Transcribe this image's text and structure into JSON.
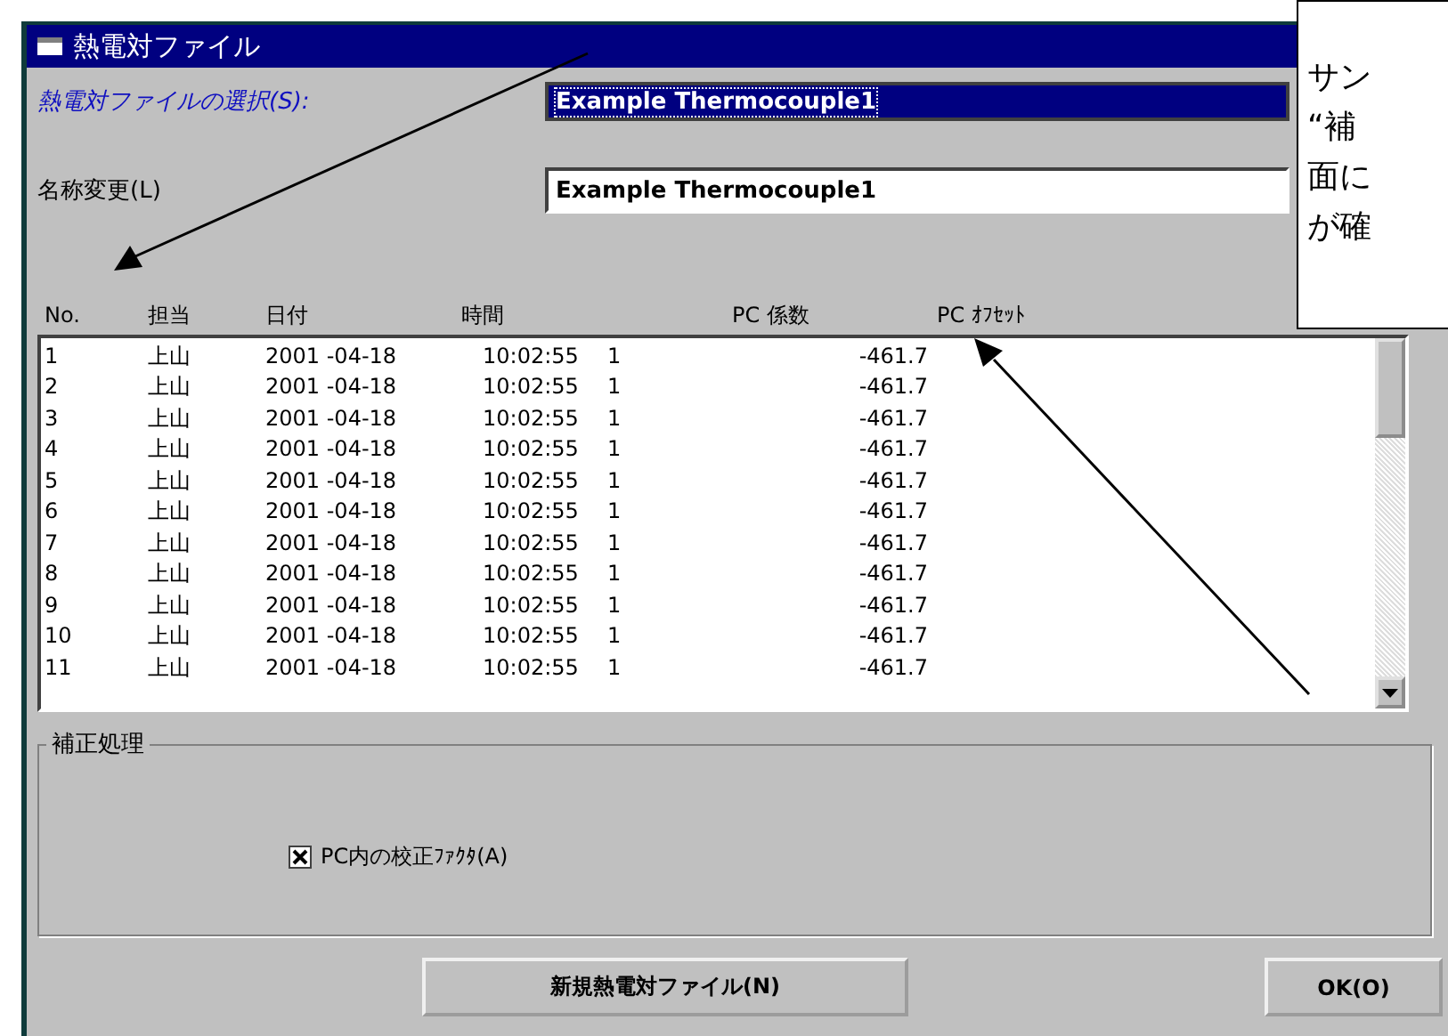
{
  "window": {
    "title": "熱電対ファイル"
  },
  "file_select": {
    "label": "熱電対ファイルの選択(S):",
    "value": "Example Thermocouple1"
  },
  "rename": {
    "label": "名称変更(L)",
    "value": "Example Thermocouple1"
  },
  "table": {
    "columns": [
      "No.",
      "担当",
      "日付",
      "時間",
      "PC 係数",
      "PC ｵﾌｾｯﾄ"
    ],
    "rows": [
      [
        "1",
        "上山",
        "2001 -04-18",
        "10:02:55",
        "1",
        "-461.7"
      ],
      [
        "2",
        "上山",
        "2001 -04-18",
        "10:02:55",
        "1",
        "-461.7"
      ],
      [
        "3",
        "上山",
        "2001 -04-18",
        "10:02:55",
        "1",
        "-461.7"
      ],
      [
        "4",
        "上山",
        "2001 -04-18",
        "10:02:55",
        "1",
        "-461.7"
      ],
      [
        "5",
        "上山",
        "2001 -04-18",
        "10:02:55",
        "1",
        "-461.7"
      ],
      [
        "6",
        "上山",
        "2001 -04-18",
        "10:02:55",
        "1",
        "-461.7"
      ],
      [
        "7",
        "上山",
        "2001 -04-18",
        "10:02:55",
        "1",
        "-461.7"
      ],
      [
        "8",
        "上山",
        "2001 -04-18",
        "10:02:55",
        "1",
        "-461.7"
      ],
      [
        "9",
        "上山",
        "2001 -04-18",
        "10:02:55",
        "1",
        "-461.7"
      ],
      [
        "10",
        "上山",
        "2001 -04-18",
        "10:02:55",
        "1",
        "-461.7"
      ],
      [
        "11",
        "上山",
        "2001 -04-18",
        "10:02:55",
        "1",
        "-461.7"
      ]
    ]
  },
  "correction": {
    "title": "補正処理",
    "checkbox": {
      "label": "PC内の校正ﾌｧｸﾀ(A)",
      "checked": true
    }
  },
  "buttons": [
    "新規熱電対ファイル(N)",
    "OK(O)"
  ],
  "callout": {
    "lines": [
      "サン",
      "“補",
      "面に",
      "が確"
    ]
  }
}
